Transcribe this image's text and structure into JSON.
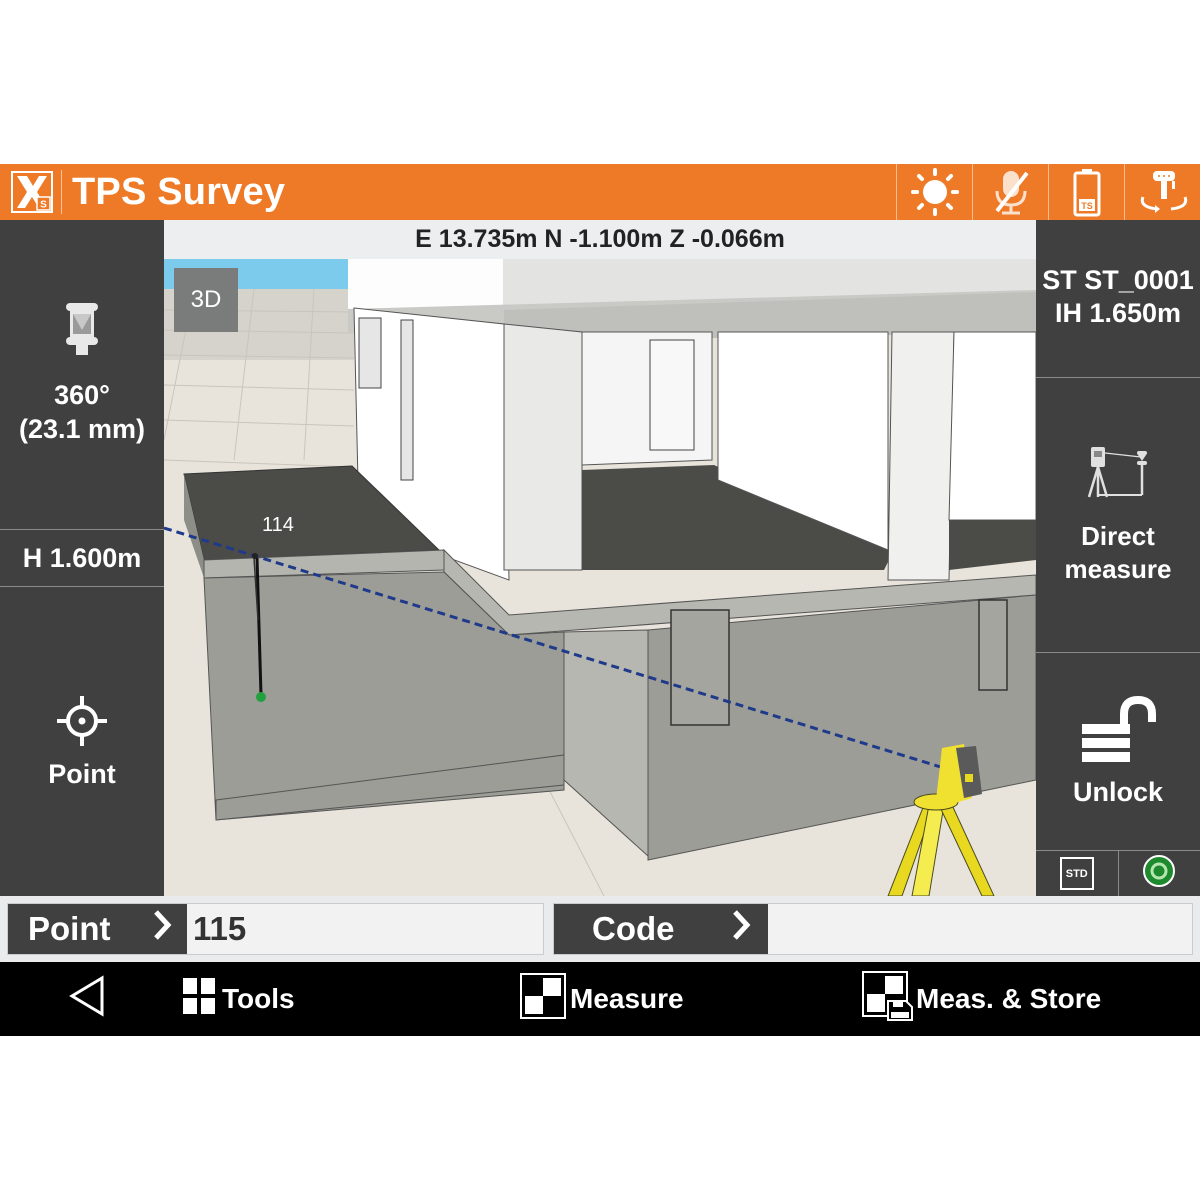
{
  "titlebar": {
    "title": "TPS Survey",
    "logo": "xpad-logo-icon",
    "status_icons": [
      "brightness-icon",
      "mic-off-icon",
      "battery-ts-icon",
      "instrument-rotate-icon"
    ]
  },
  "left_panel": {
    "prism_icon": "prism-360-icon",
    "prism_type": "360°",
    "prism_constant": "(23.1 mm)",
    "target_height": "H 1.600m",
    "point_label": "Point",
    "point_icon": "crosshair-icon"
  },
  "viewport": {
    "coordinates": "E 13.735m N -1.100m Z -0.066m",
    "view_mode_button": "3D",
    "last_point_label": "114",
    "colors": {
      "sky": "#7dcbec",
      "ground": "#e8e4dc",
      "line_of_sight": "#1f3a8a",
      "point_marker": "#22a040",
      "instrument": "#f0e030"
    }
  },
  "right_panel": {
    "station_line1": "ST ST_0001",
    "station_line2": "IH 1.650m",
    "direct_measure_line1": "Direct",
    "direct_measure_line2": "measure",
    "unlock_label": "Unlock",
    "std_label": "STD",
    "tracking_status_color": "#1e8a2e"
  },
  "input_row": {
    "point_label": "Point",
    "point_value": "115",
    "code_label": "Code",
    "code_value": ""
  },
  "bottombar": {
    "back_icon": "back-triangle-icon",
    "tools_label": "Tools",
    "measure_label": "Measure",
    "meas_store_label": "Meas. & Store"
  },
  "colors": {
    "accent": "#ee7a27",
    "panel": "#404040",
    "bottombar": "#000000"
  }
}
